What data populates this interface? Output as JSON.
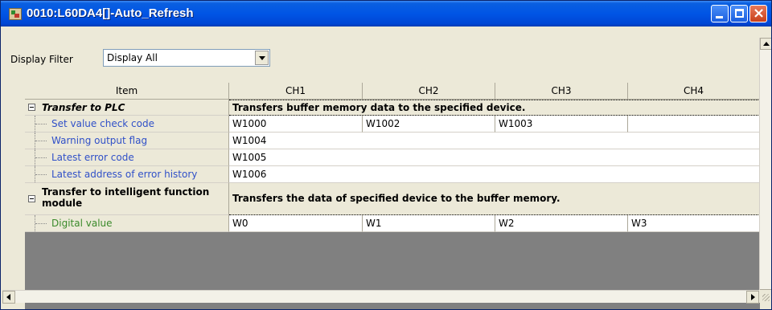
{
  "window": {
    "title": "0010:L60DA4[]-Auto_Refresh",
    "controls": [
      "minimize",
      "maximize",
      "close"
    ]
  },
  "filter": {
    "label": "Display Filter",
    "selected": "Display All"
  },
  "grid": {
    "headers": {
      "item": "Item",
      "ch1": "CH1",
      "ch2": "CH2",
      "ch3": "CH3",
      "ch4": "CH4"
    },
    "groups": [
      {
        "label": "Transfer to PLC",
        "description": "Transfers buffer memory data to the specified device.",
        "rows": [
          {
            "item": "Set value check code",
            "ch1": "W1000",
            "ch2": "W1002",
            "ch3": "W1003",
            "ch4": ""
          },
          {
            "item": "Warning output flag",
            "value": "W1004"
          },
          {
            "item": "Latest error code",
            "value": "W1005"
          },
          {
            "item": "Latest address of error history",
            "value": "W1006"
          }
        ]
      },
      {
        "label": "Transfer to intelligent function module",
        "description": "Transfers the data of specified device to the buffer memory.",
        "rows": [
          {
            "item": "Digital value",
            "ch1": "W0",
            "ch2": "W1",
            "ch3": "W2",
            "ch4": "W3"
          }
        ]
      }
    ]
  },
  "icons": {
    "app": "plc-module-icon",
    "expander": "collapse-minus-icon"
  }
}
